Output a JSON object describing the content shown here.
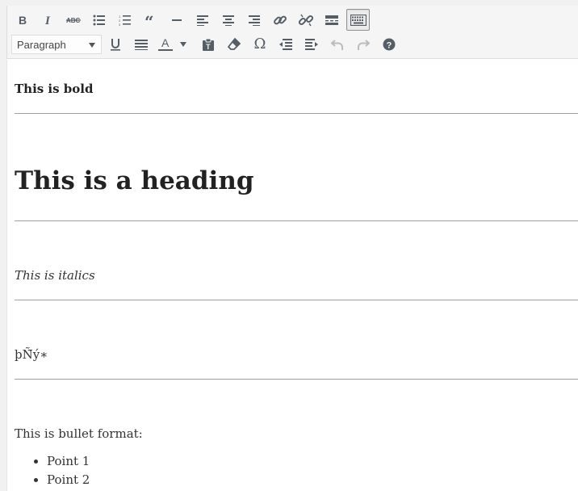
{
  "toolbar": {
    "row1": [
      {
        "name": "bold-button",
        "icon": "bold-icon"
      },
      {
        "name": "italic-button",
        "icon": "italic-icon"
      },
      {
        "name": "strikethrough-button",
        "icon": "strikethrough-icon",
        "text": "ABC"
      },
      {
        "name": "bullet-list-button",
        "icon": "bullet-list-icon"
      },
      {
        "name": "numbered-list-button",
        "icon": "numbered-list-icon"
      },
      {
        "name": "blockquote-button",
        "icon": "quote-icon"
      },
      {
        "name": "horizontal-line-button",
        "icon": "horizontal-line-icon"
      },
      {
        "name": "align-left-button",
        "icon": "align-left-icon"
      },
      {
        "name": "align-center-button",
        "icon": "align-center-icon"
      },
      {
        "name": "align-right-button",
        "icon": "align-right-icon"
      },
      {
        "name": "insert-link-button",
        "icon": "link-icon"
      },
      {
        "name": "remove-link-button",
        "icon": "unlink-icon"
      },
      {
        "name": "read-more-button",
        "icon": "read-more-icon"
      },
      {
        "name": "toolbar-toggle-button",
        "icon": "keyboard-icon",
        "active": true
      }
    ],
    "format_select": {
      "value": "Paragraph"
    },
    "row2": [
      {
        "name": "underline-button",
        "icon": "underline-icon"
      },
      {
        "name": "justify-button",
        "icon": "justify-icon"
      },
      {
        "name": "text-color-button",
        "icon": "text-color-icon",
        "text": "A"
      },
      {
        "name": "paste-text-button",
        "icon": "paste-icon"
      },
      {
        "name": "clear-formatting-button",
        "icon": "eraser-icon"
      },
      {
        "name": "special-character-button",
        "icon": "omega-icon",
        "text": "Ω"
      },
      {
        "name": "decrease-indent-button",
        "icon": "outdent-icon"
      },
      {
        "name": "increase-indent-button",
        "icon": "indent-icon"
      },
      {
        "name": "undo-button",
        "icon": "undo-icon",
        "disabled": true
      },
      {
        "name": "redo-button",
        "icon": "redo-icon",
        "disabled": true
      },
      {
        "name": "help-button",
        "icon": "help-icon",
        "text": "?"
      }
    ]
  },
  "content": {
    "bold_text": "This is bold",
    "heading": "This is a heading",
    "italic_text": "This is italics",
    "symbol_text": "þÑ̃ý∗",
    "bullet_intro": "This is bullet format:",
    "bullets": [
      "Point 1",
      "Point 2"
    ]
  },
  "colors": {
    "toolbar_bg": "#f5f5f5",
    "icon": "#555d66",
    "icon_disabled": "#b9bcc0",
    "separator": "#a0a0a0"
  }
}
